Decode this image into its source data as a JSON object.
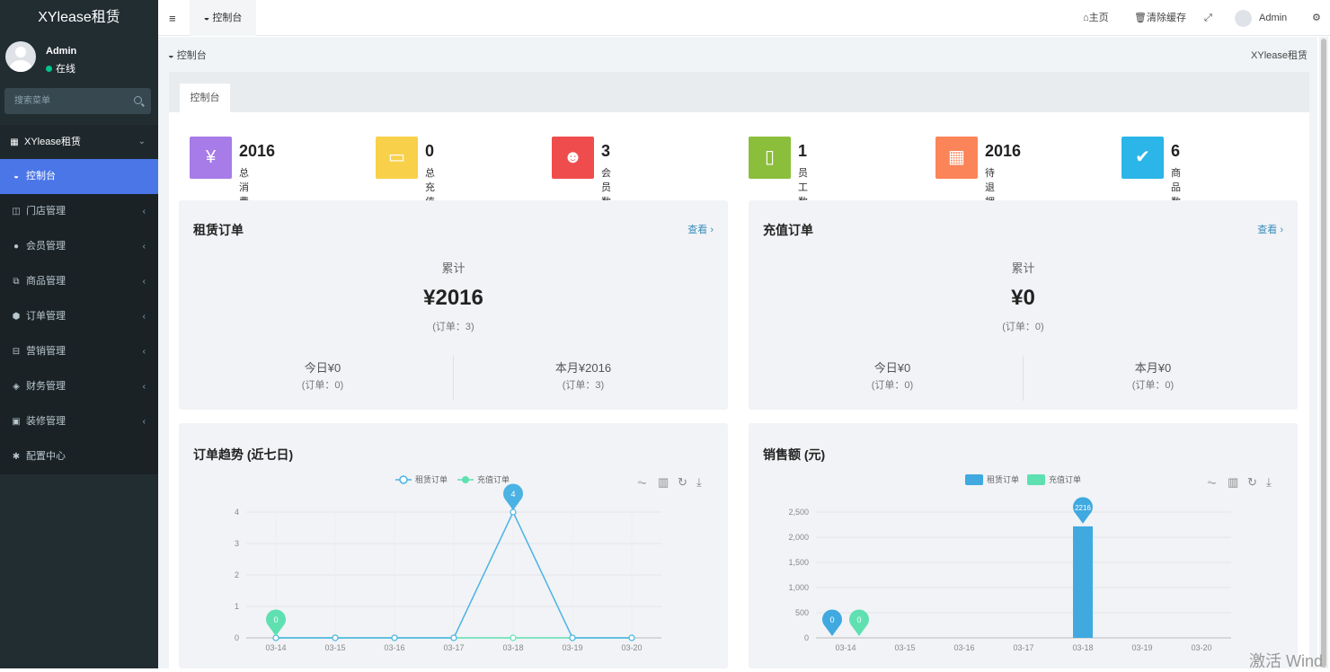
{
  "sidebar": {
    "brand": "XYlease租赁",
    "user_name": "Admin",
    "user_status": "在线",
    "search_placeholder": "搜索菜单",
    "menu_header": "XYlease租赁",
    "items": [
      {
        "label": "控制台",
        "icon": "dashboard-icon",
        "active": true
      },
      {
        "label": "门店管理",
        "icon": "store-icon"
      },
      {
        "label": "会员管理",
        "icon": "user-icon"
      },
      {
        "label": "商品管理",
        "icon": "goods-icon"
      },
      {
        "label": "订单管理",
        "icon": "order-icon"
      },
      {
        "label": "营销管理",
        "icon": "marketing-icon"
      },
      {
        "label": "财务管理",
        "icon": "finance-icon"
      },
      {
        "label": "装修管理",
        "icon": "decoration-icon"
      },
      {
        "label": "配置中心",
        "icon": "gear-icon"
      }
    ]
  },
  "topbar": {
    "tab_label": "控制台",
    "home": "主页",
    "clear_cache": "清除缓存",
    "admin": "Admin"
  },
  "breadcrumb": {
    "left": "控制台",
    "right": "XYlease租赁"
  },
  "tab_card": "控制台",
  "stats": [
    {
      "value": "2016",
      "label": "总消费",
      "color": "#a77be8",
      "icon": "yen-icon"
    },
    {
      "value": "0",
      "label": "总充值",
      "color": "#f9d04a",
      "icon": "archive-icon"
    },
    {
      "value": "3",
      "label": "会员数",
      "color": "#ef4d4d",
      "icon": "users-icon"
    },
    {
      "value": "1",
      "label": "员工数",
      "color": "#8bbe3b",
      "icon": "badge-icon"
    },
    {
      "value": "2016",
      "label": "待退押金",
      "color": "#fb8458",
      "icon": "grid-icon"
    },
    {
      "value": "6",
      "label": "商品数",
      "color": "#2bb5e8",
      "icon": "check-icon"
    }
  ],
  "rental_card": {
    "title": "租赁订单",
    "link": "查看 ›",
    "total_label": "累计",
    "total": "¥2016",
    "total_orders": "(订单：3)",
    "today": "今日¥0",
    "today_orders": "(订单：0)",
    "month": "本月¥2016",
    "month_orders": "(订单：3)"
  },
  "recharge_card": {
    "title": "充值订单",
    "link": "查看 ›",
    "total_label": "累计",
    "total": "¥0",
    "total_orders": "(订单：0)",
    "today": "今日¥0",
    "today_orders": "(订单：0)",
    "month": "本月¥0",
    "month_orders": "(订单：0)"
  },
  "trend_card": {
    "title": "订单趋势 (近七日)",
    "legend_rental": "租赁订单",
    "legend_recharge": "充值订单"
  },
  "sales_card": {
    "title": "销售额 (元)",
    "legend_rental": "租赁订单",
    "legend_recharge": "充值订单"
  },
  "windows_text": "激活 Wind",
  "chart_data": [
    {
      "type": "line",
      "title": "订单趋势 (近七日)",
      "x": [
        "03-14",
        "03-15",
        "03-16",
        "03-17",
        "03-18",
        "03-19",
        "03-20"
      ],
      "ylim": [
        0,
        4
      ],
      "yticks": [
        0,
        1,
        2,
        3,
        4
      ],
      "series": [
        {
          "name": "租赁订单",
          "color": "#4bb3e3",
          "values": [
            0,
            0,
            0,
            0,
            4,
            0,
            0
          ],
          "max_pin": "4"
        },
        {
          "name": "充值订单",
          "color": "#5fe0b1",
          "values": [
            0,
            0,
            0,
            0,
            0,
            0,
            0
          ],
          "max_pin": "0"
        }
      ]
    },
    {
      "type": "bar",
      "title": "销售额 (元)",
      "categories": [
        "03-14",
        "03-15",
        "03-16",
        "03-17",
        "03-18",
        "03-19",
        "03-20"
      ],
      "ylim": [
        0,
        2500
      ],
      "yticks": [
        "0",
        "500",
        "1,000",
        "1,500",
        "2,000",
        "2,500"
      ],
      "series": [
        {
          "name": "租赁订单",
          "color": "#3fa9e0",
          "values": [
            0,
            0,
            0,
            0,
            2216,
            0,
            0
          ],
          "max_pin": "2216",
          "min_pin": "0"
        },
        {
          "name": "充值订单",
          "color": "#5fe0b1",
          "values": [
            0,
            0,
            0,
            0,
            0,
            0,
            0
          ],
          "min_pin": "0"
        }
      ]
    }
  ]
}
